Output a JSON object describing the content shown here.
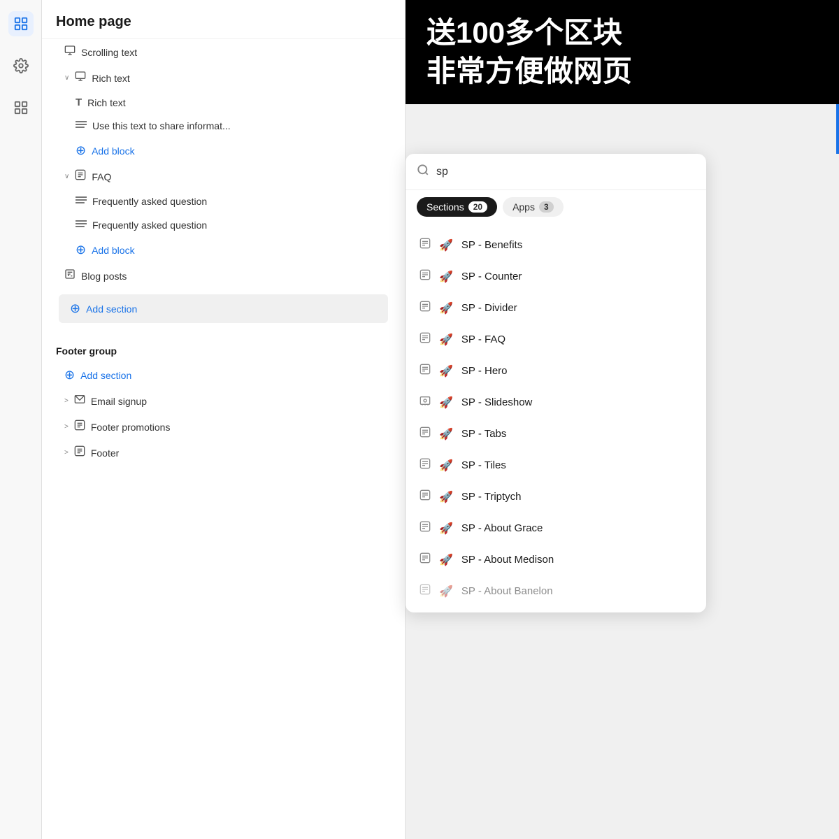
{
  "sidebar": {
    "icons": [
      {
        "name": "layers-icon",
        "symbol": "⊟",
        "active": true
      },
      {
        "name": "settings-icon",
        "symbol": "⚙",
        "active": false
      },
      {
        "name": "grid-icon",
        "symbol": "⊞",
        "active": false
      }
    ]
  },
  "page_tree": {
    "title": "Home page",
    "items": [
      {
        "type": "section",
        "icon": "☰",
        "label": "Scrolling text",
        "indent": 1,
        "chevron": ""
      },
      {
        "type": "section-open",
        "icon": "☰",
        "label": "Rich text",
        "indent": 1,
        "chevron": "∨"
      },
      {
        "type": "child",
        "icon": "T",
        "label": "Rich text",
        "indent": 2
      },
      {
        "type": "child",
        "icon": "≡",
        "label": "Use this text to share informat...",
        "indent": 2
      },
      {
        "type": "add-block",
        "icon": "⊕",
        "label": "Add block",
        "indent": 2
      },
      {
        "type": "section-open",
        "icon": "⊟",
        "label": "FAQ",
        "indent": 1,
        "chevron": "∨"
      },
      {
        "type": "child",
        "icon": "≡",
        "label": "Frequently asked question",
        "indent": 2
      },
      {
        "type": "child",
        "icon": "≡",
        "label": "Frequently asked question",
        "indent": 2
      },
      {
        "type": "add-block",
        "icon": "⊕",
        "label": "Add block",
        "indent": 2
      },
      {
        "type": "section",
        "icon": "✎",
        "label": "Blog posts",
        "indent": 1
      },
      {
        "type": "add-section",
        "icon": "⊕",
        "label": "Add section",
        "indent": 1
      }
    ],
    "footer_group": {
      "title": "Footer group",
      "items": [
        {
          "type": "add-section",
          "icon": "⊕",
          "label": "Add section",
          "indent": 1
        },
        {
          "type": "section",
          "icon": "✉",
          "label": "Email signup",
          "indent": 1,
          "chevron": ">"
        },
        {
          "type": "section",
          "icon": "⊟",
          "label": "Footer promotions",
          "indent": 1,
          "chevron": ">"
        },
        {
          "type": "section",
          "icon": "⊟",
          "label": "Footer",
          "indent": 1,
          "chevron": ">"
        }
      ]
    }
  },
  "banner": {
    "line1": "送100多个区块",
    "line2": "非常方便做网页"
  },
  "search_panel": {
    "placeholder": "sp",
    "search_value": "sp",
    "tabs": [
      {
        "label": "Sections",
        "count": "20",
        "active": true
      },
      {
        "label": "Apps",
        "count": "3",
        "active": false
      }
    ],
    "results": [
      {
        "icon": "⊟",
        "emoji": "🚀",
        "label": "SP - Benefits"
      },
      {
        "icon": "⊟",
        "emoji": "🚀",
        "label": "SP - Counter"
      },
      {
        "icon": "⊟",
        "emoji": "🚀",
        "label": "SP - Divider"
      },
      {
        "icon": "⊟",
        "emoji": "🚀",
        "label": "SP - FAQ"
      },
      {
        "icon": "⊟",
        "emoji": "🚀",
        "label": "SP - Hero"
      },
      {
        "icon": "⊟",
        "emoji": "🚀",
        "label": "SP - Slideshow"
      },
      {
        "icon": "⊟",
        "emoji": "🚀",
        "label": "SP - Tabs"
      },
      {
        "icon": "⊟",
        "emoji": "🚀",
        "label": "SP - Tiles"
      },
      {
        "icon": "⊟",
        "emoji": "🚀",
        "label": "SP - Triptych"
      },
      {
        "icon": "⊟",
        "emoji": "🚀",
        "label": "SP - About Grace"
      },
      {
        "icon": "⊟",
        "emoji": "🚀",
        "label": "SP - About Medison"
      },
      {
        "icon": "⊟",
        "emoji": "🚀",
        "label": "SP - About Banelon"
      }
    ]
  }
}
